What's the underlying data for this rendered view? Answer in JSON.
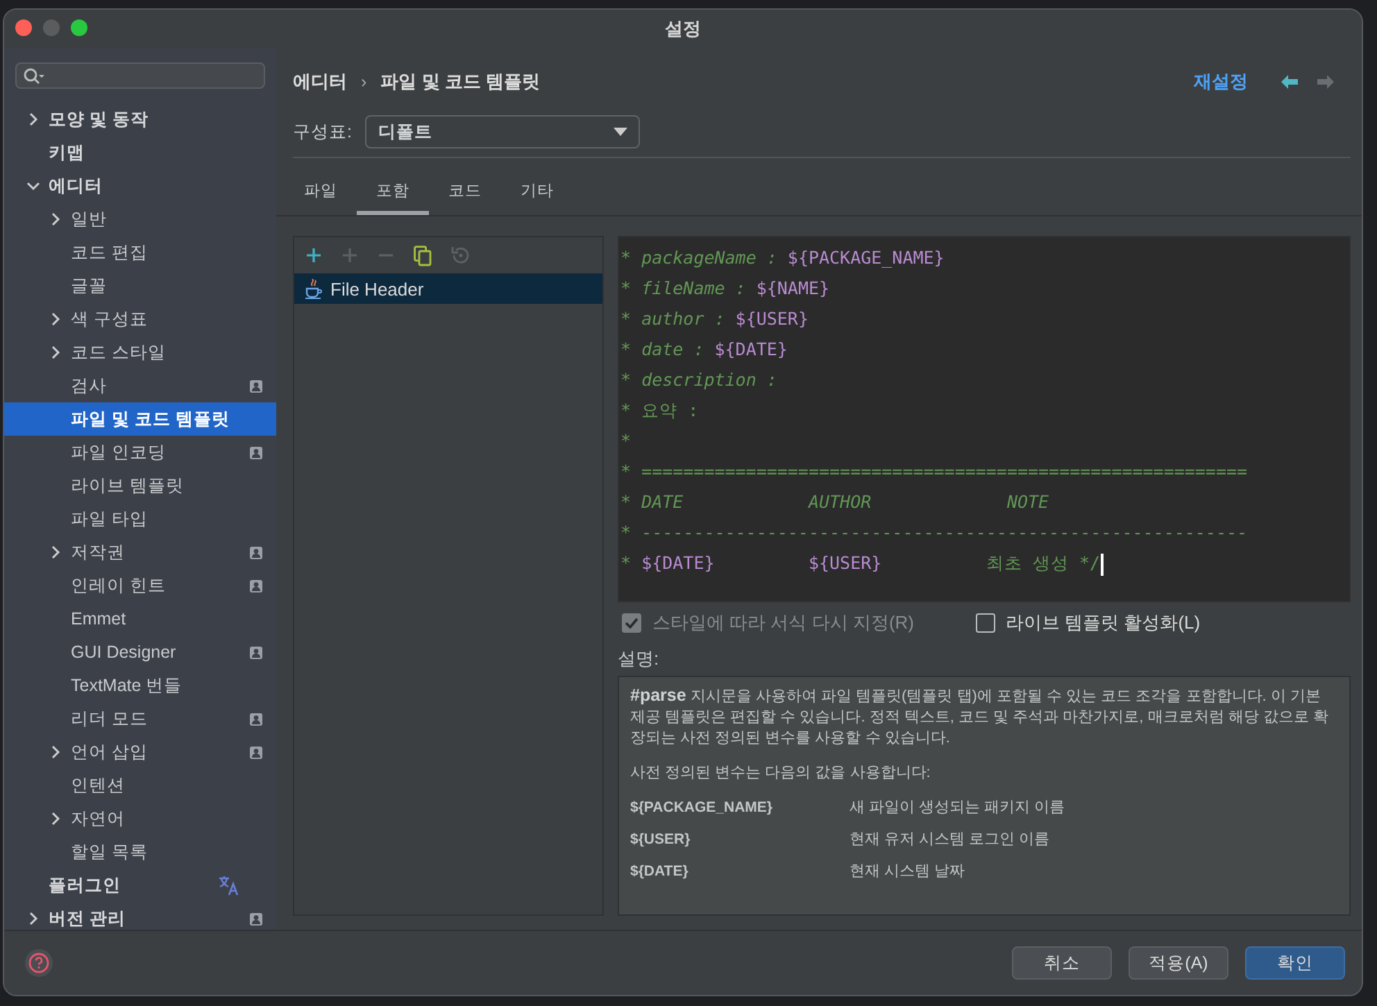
{
  "window": {
    "title": "설정"
  },
  "sidebar": {
    "items": [
      {
        "label": "모양 및 동작",
        "expanded": false,
        "badge": false,
        "selected": false
      },
      {
        "label": "키맵",
        "badge": false,
        "selected": false
      },
      {
        "label": "에디터",
        "expanded": true,
        "badge": false,
        "selected": false,
        "children": [
          {
            "label": "일반",
            "expanded": false,
            "badge": false,
            "selected": false
          },
          {
            "label": "코드 편집",
            "badge": false,
            "selected": false
          },
          {
            "label": "글꼴",
            "badge": false,
            "selected": false
          },
          {
            "label": "색 구성표",
            "expanded": false,
            "badge": false,
            "selected": false
          },
          {
            "label": "코드 스타일",
            "expanded": false,
            "badge": false,
            "selected": false
          },
          {
            "label": "검사",
            "badge": true,
            "selected": false
          },
          {
            "label": "파일 및 코드 템플릿",
            "badge": false,
            "selected": true
          },
          {
            "label": "파일 인코딩",
            "badge": true,
            "selected": false
          },
          {
            "label": "라이브 템플릿",
            "badge": false,
            "selected": false
          },
          {
            "label": "파일 타입",
            "badge": false,
            "selected": false
          },
          {
            "label": "저작권",
            "expanded": false,
            "badge": true,
            "selected": false
          },
          {
            "label": "인레이 힌트",
            "badge": true,
            "selected": false
          },
          {
            "label": "Emmet",
            "badge": false,
            "selected": false
          },
          {
            "label": "GUI Designer",
            "badge": true,
            "selected": false
          },
          {
            "label": "TextMate 번들",
            "badge": false,
            "selected": false
          },
          {
            "label": "리더 모드",
            "badge": true,
            "selected": false
          },
          {
            "label": "언어 삽입",
            "expanded": false,
            "badge": true,
            "selected": false
          },
          {
            "label": "인텐션",
            "badge": false,
            "selected": false
          },
          {
            "label": "자연어",
            "expanded": false,
            "badge": false,
            "selected": false
          },
          {
            "label": "할일 목록",
            "badge": false,
            "selected": false
          }
        ]
      },
      {
        "label": "플러그인",
        "badge": false,
        "translate": true,
        "selected": false
      },
      {
        "label": "버전 관리",
        "expanded": false,
        "badge": true,
        "selected": false
      }
    ]
  },
  "breadcrumb": [
    "에디터",
    "›",
    "파일 및 코드 템플릿"
  ],
  "reset_link": "재설정",
  "scheme": {
    "label": "구성표:",
    "value": "디폴트"
  },
  "tabs": [
    {
      "label": "파일",
      "selected": false
    },
    {
      "label": "포함",
      "selected": true
    },
    {
      "label": "코드",
      "selected": false
    },
    {
      "label": "기타",
      "selected": false
    }
  ],
  "template_list": [
    {
      "label": "File Header",
      "selected": true
    }
  ],
  "code_lines": [
    [
      {
        "kind": "text",
        "text": "* "
      },
      {
        "kind": "doc",
        "text": "packageName : "
      },
      {
        "kind": "var",
        "text": "${PACKAGE_NAME}"
      }
    ],
    [
      {
        "kind": "text",
        "text": "* "
      },
      {
        "kind": "doc",
        "text": "fileName : "
      },
      {
        "kind": "var",
        "text": "${NAME}"
      }
    ],
    [
      {
        "kind": "text",
        "text": "* "
      },
      {
        "kind": "doc",
        "text": "author : "
      },
      {
        "kind": "var",
        "text": "${USER}"
      }
    ],
    [
      {
        "kind": "text",
        "text": "* "
      },
      {
        "kind": "doc",
        "text": "date : "
      },
      {
        "kind": "var",
        "text": "${DATE}"
      }
    ],
    [
      {
        "kind": "text",
        "text": "* "
      },
      {
        "kind": "doc",
        "text": "description :"
      }
    ],
    [
      {
        "kind": "text",
        "text": "* 요약 :"
      }
    ],
    [
      {
        "kind": "text",
        "text": "*"
      }
    ],
    [
      {
        "kind": "text",
        "text": "* =========================================================="
      }
    ],
    [
      {
        "kind": "text",
        "text": "* "
      },
      {
        "kind": "doc",
        "text": "DATE            AUTHOR             NOTE"
      }
    ],
    [
      {
        "kind": "text",
        "text": "* ----------------------------------------------------------"
      }
    ],
    [
      {
        "kind": "text",
        "text": "* "
      },
      {
        "kind": "var",
        "text": "${DATE}         ${USER}          "
      },
      {
        "kind": "text",
        "text": "최초 생성 */"
      }
    ]
  ],
  "options": [
    {
      "label": "스타일에 따라 서식 다시 지정(R)",
      "checked": true,
      "disabled": true
    },
    {
      "label": "라이브 템플릿 활성화(L)",
      "checked": false,
      "disabled": false
    }
  ],
  "description": {
    "label": "설명:",
    "paragraphs": [
      "**#parse** 지시문을 사용하여 파일 템플릿(템플릿 탭)에 포함될 수 있는 코드 조각을 포함합니다. 이 기본 제공 템플릿은 편집할 수 있습니다. 정적 텍스트, 코드 및 주석과 마찬가지로, 매크로처럼 해당 값으로 확장되는 사전 정의된 변수를 사용할 수 있습니다.",
      "사전 정의된 변수는 다음의 값을 사용합니다:"
    ],
    "variables": [
      {
        "name": "${PACKAGE_NAME}",
        "meaning": "새 파일이 생성되는 패키지 이름"
      },
      {
        "name": "${USER}",
        "meaning": "현재 유저 시스템 로그인 이름"
      },
      {
        "name": "${DATE}",
        "meaning": "현재 시스템 날짜"
      }
    ]
  },
  "buttons": [
    {
      "label": "취소",
      "primary": false
    },
    {
      "label": "적용(A)",
      "primary": false
    },
    {
      "label": "확인",
      "primary": true
    }
  ]
}
